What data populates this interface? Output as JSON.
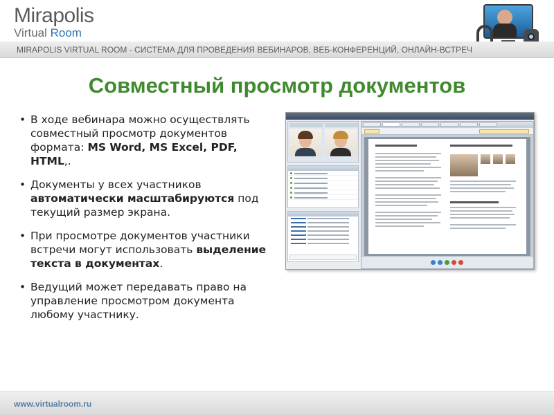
{
  "header": {
    "logo_main": "Mirapolis",
    "logo_sub_prefix": "Virtual ",
    "logo_sub_accent": "Room",
    "tagline": "MIRAPOLIS VIRTUAL ROOM - СИСТЕМА ДЛЯ ПРОВЕДЕНИЯ ВЕБИНАРОВ, ВЕБ-КОНФЕРЕНЦИЙ, ОНЛАЙН-ВСТРЕЧ"
  },
  "title": "Совместный просмотр документов",
  "bullets": [
    {
      "text_a": "В ходе вебинара можно осуществлять совместный просмотр документов формата: ",
      "bold": "MS Word, MS Excel, PDF, HTML",
      "text_b": ",."
    },
    {
      "text_a": "Документы у всех участников ",
      "bold": "автоматически масштабируются",
      "text_b": " под текущий размер экрана."
    },
    {
      "text_a": "При просмотре документов участники встречи могут использовать ",
      "bold": "выделение текста в документах",
      "text_b": "."
    },
    {
      "text_a": "Ведущий может передавать право на управление просмотром документа любому участнику.",
      "bold": "",
      "text_b": ""
    }
  ],
  "screenshot": {
    "colors": {
      "topbar": "#3b4b60",
      "panel": "#dfe6ee",
      "accent_green": "#4c9a3b"
    }
  },
  "footer": {
    "link": "www.virtualroom.ru"
  },
  "colors": {
    "title": "#3f8a2f",
    "logo_accent": "#2e74b5",
    "footer_link": "#5b7fa6"
  }
}
